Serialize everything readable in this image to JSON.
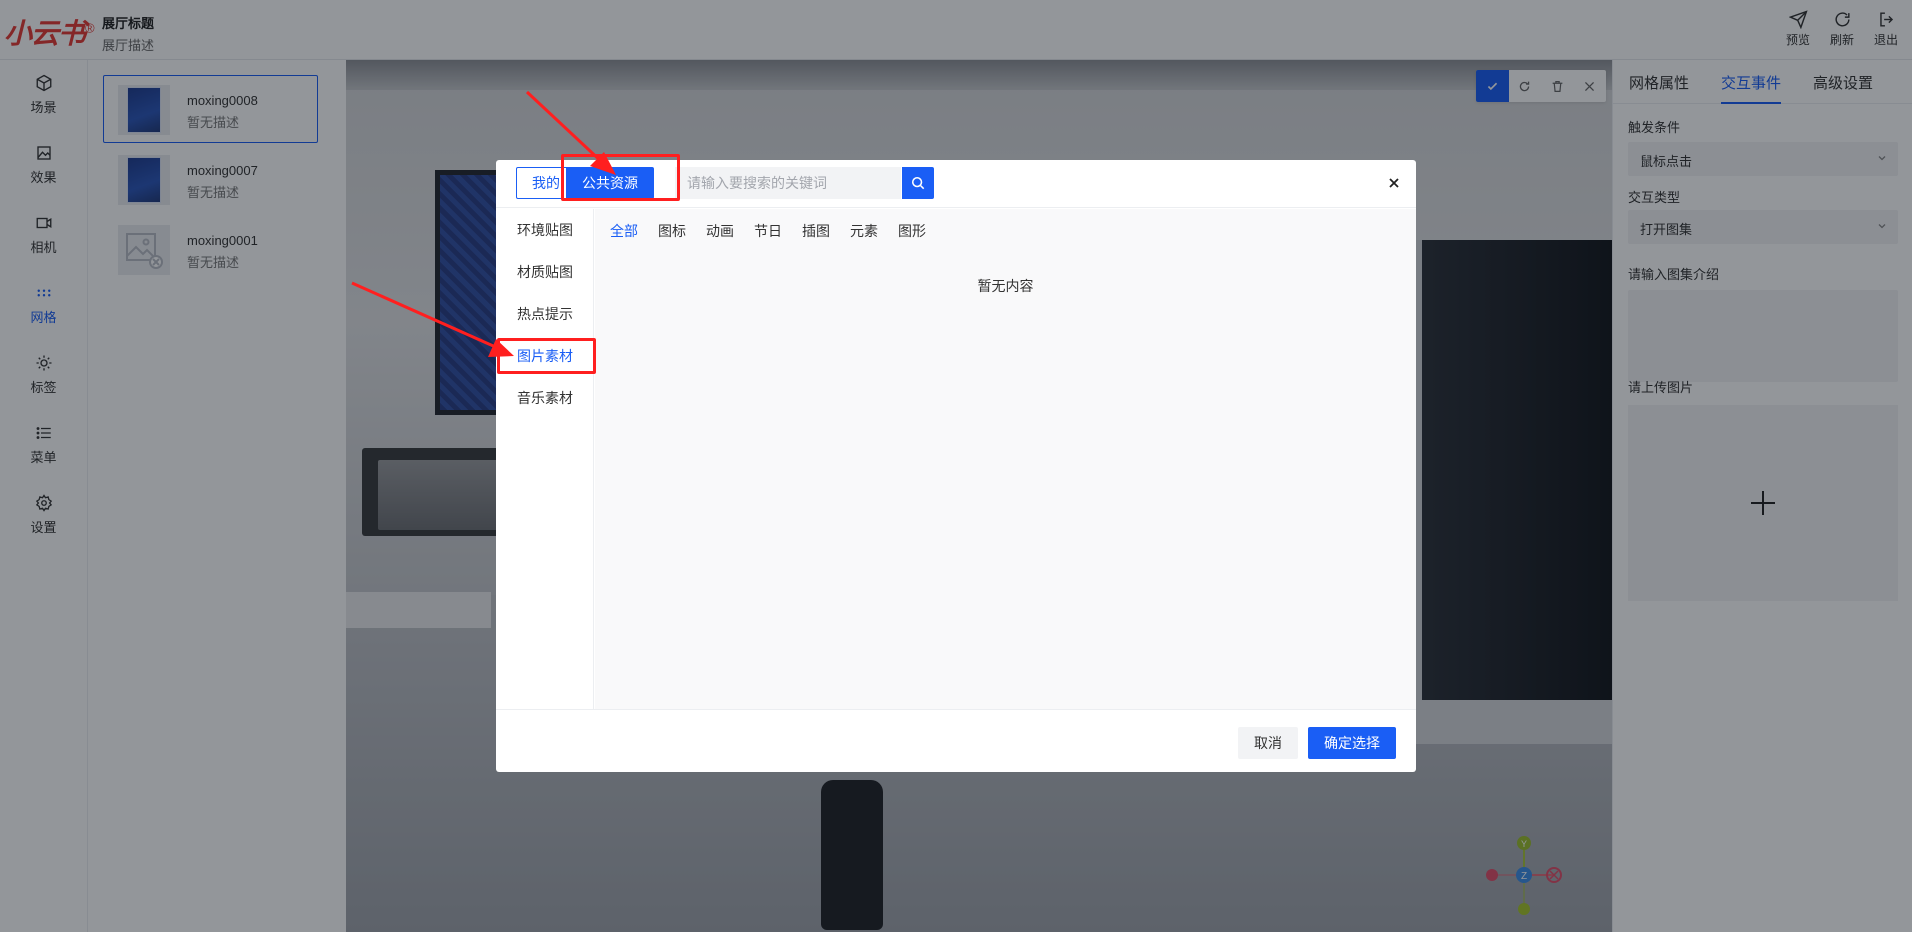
{
  "header": {
    "logo": "小云书",
    "logo_mark": "®",
    "hall_title": "展厅标题",
    "hall_desc": "展厅描述",
    "actions": [
      {
        "label": "预览",
        "icon": "send-icon"
      },
      {
        "label": "刷新",
        "icon": "refresh-icon"
      },
      {
        "label": "退出",
        "icon": "logout-icon"
      }
    ]
  },
  "sidebar": {
    "items": [
      {
        "label": "场景",
        "icon": "cube-icon"
      },
      {
        "label": "效果",
        "icon": "effect-icon"
      },
      {
        "label": "相机",
        "icon": "camera-icon"
      },
      {
        "label": "网格",
        "icon": "grid-icon",
        "active": true
      },
      {
        "label": "标签",
        "icon": "tag-icon"
      },
      {
        "label": "菜单",
        "icon": "menu-icon"
      },
      {
        "label": "设置",
        "icon": "gear-icon"
      }
    ]
  },
  "assets": [
    {
      "name": "moxing0008",
      "desc": "暂无描述",
      "selected": true
    },
    {
      "name": "moxing0007",
      "desc": "暂无描述"
    },
    {
      "name": "moxing0001",
      "desc": "暂无描述",
      "broken": true
    }
  ],
  "gizmo": {
    "y": "Y",
    "z": "Z"
  },
  "right_panel": {
    "tabs": [
      "网格属性",
      "交互事件",
      "高级设置"
    ],
    "active_tab": 1,
    "trigger_label": "触发条件",
    "trigger_value": "鼠标点击",
    "type_label": "交互类型",
    "type_value": "打开图集",
    "intro_label": "请输入图集介绍",
    "upload_label": "请上传图片"
  },
  "dialog": {
    "source_tabs": [
      "我的",
      "公共资源"
    ],
    "active_source": 1,
    "search_placeholder": "请输入要搜索的关键词",
    "categories": [
      "环境贴图",
      "材质贴图",
      "热点提示",
      "图片素材",
      "音乐素材"
    ],
    "active_category": 3,
    "filters": [
      "全部",
      "图标",
      "动画",
      "节日",
      "插图",
      "元素",
      "图形"
    ],
    "active_filter": 0,
    "empty_text": "暂无内容",
    "cancel_label": "取消",
    "confirm_label": "确定选择"
  },
  "colors": {
    "primary": "#1a5ef5",
    "highlight": "#ff1f1f",
    "logo": "#e53935"
  }
}
